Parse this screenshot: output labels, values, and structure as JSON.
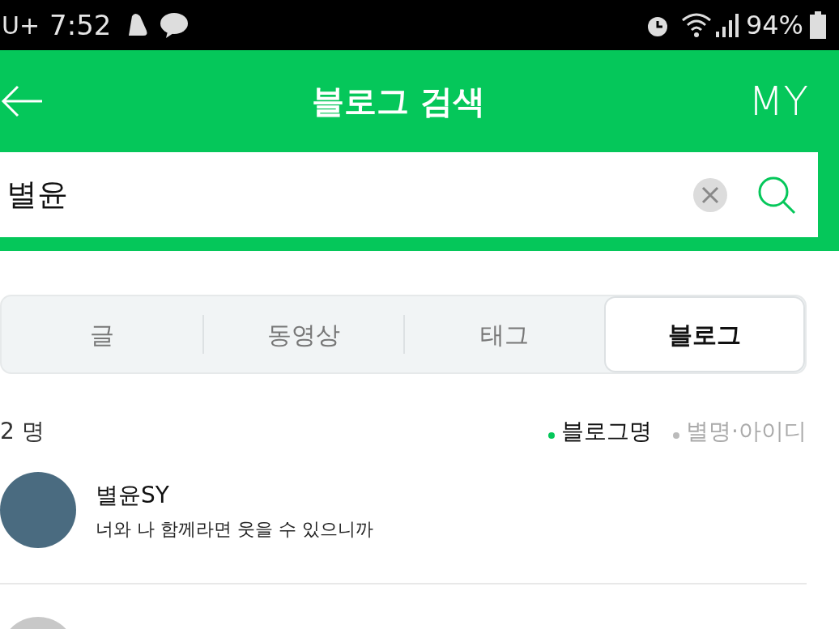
{
  "status_bar": {
    "carrier": "U+",
    "time": "7:52",
    "battery": "94%"
  },
  "header": {
    "title": "블로그 검색",
    "my": "MY"
  },
  "search": {
    "value": "별윤"
  },
  "tabs": [
    {
      "label": "글",
      "selected": false
    },
    {
      "label": "동영상",
      "selected": false
    },
    {
      "label": "태그",
      "selected": false
    },
    {
      "label": "블로그",
      "selected": true
    }
  ],
  "result_count": "2 명",
  "sort_options": [
    {
      "label": "블로그명",
      "selected": true
    },
    {
      "label": "별명·아이디",
      "selected": false
    }
  ],
  "results": [
    {
      "name": "별윤SY",
      "description": "너와 나 함께라면 웃을 수 있으니까"
    },
    {
      "kind": "cut_off"
    }
  ]
}
